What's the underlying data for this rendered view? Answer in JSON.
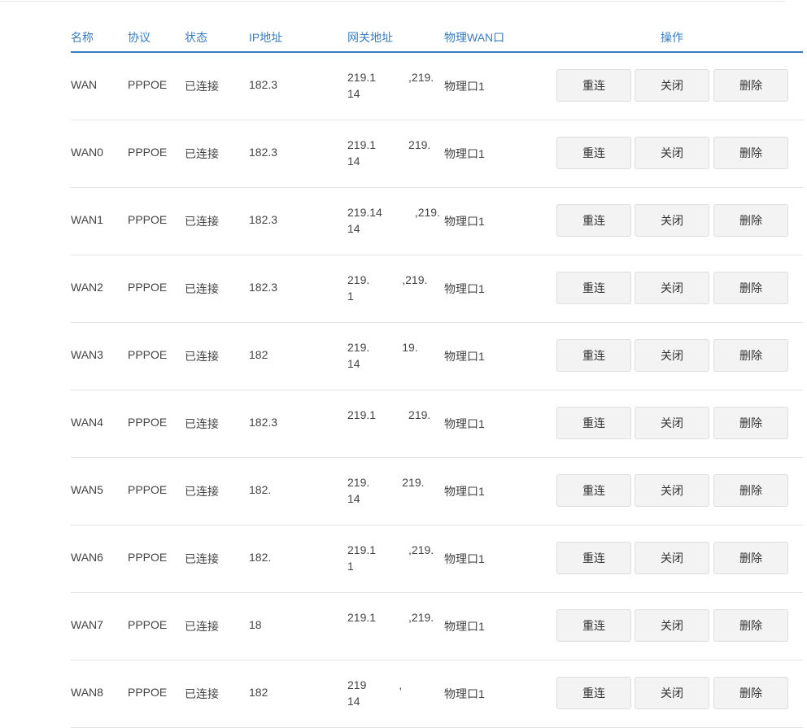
{
  "table": {
    "headers": {
      "name": "名称",
      "protocol": "协议",
      "status": "状态",
      "ip": "IP地址",
      "gateway": "网关地址",
      "port": "物理WAN口",
      "ops": "操作"
    },
    "rows": [
      {
        "name": "WAN",
        "protocol": "PPPOE",
        "status": "已连接",
        "ip": "182.3",
        "gateway_line1": "219.1",
        "gateway_tail": ",219.",
        "gateway_line2": "14",
        "port": "物理口1",
        "reconnect": "重连",
        "close": "关闭",
        "delete": "删除"
      },
      {
        "name": "WAN0",
        "protocol": "PPPOE",
        "status": "已连接",
        "ip": "182.3",
        "gateway_line1": "219.1",
        "gateway_tail": "219.",
        "gateway_line2": "14",
        "port": "物理口1",
        "reconnect": "重连",
        "close": "关闭",
        "delete": "删除"
      },
      {
        "name": "WAN1",
        "protocol": "PPPOE",
        "status": "已连接",
        "ip": "182.3",
        "gateway_line1": "219.14",
        "gateway_tail": ",219.",
        "gateway_line2": "14",
        "port": "物理口1",
        "reconnect": "重连",
        "close": "关闭",
        "delete": "删除"
      },
      {
        "name": "WAN2",
        "protocol": "PPPOE",
        "status": "已连接",
        "ip": "182.3",
        "gateway_line1": "219.",
        "gateway_tail": ",219.",
        "gateway_line2": "1",
        "port": "物理口1",
        "reconnect": "重连",
        "close": "关闭",
        "delete": "删除"
      },
      {
        "name": "WAN3",
        "protocol": "PPPOE",
        "status": "已连接",
        "ip": "182",
        "gateway_line1": "219.",
        "gateway_tail": "19.",
        "gateway_line2": "14",
        "port": "物理口1",
        "reconnect": "重连",
        "close": "关闭",
        "delete": "删除"
      },
      {
        "name": "WAN4",
        "protocol": "PPPOE",
        "status": "已连接",
        "ip": "182.3",
        "gateway_line1": "219.1",
        "gateway_tail": "219.",
        "gateway_line2": "",
        "port": "物理口1",
        "reconnect": "重连",
        "close": "关闭",
        "delete": "删除"
      },
      {
        "name": "WAN5",
        "protocol": "PPPOE",
        "status": "已连接",
        "ip": "182.",
        "gateway_line1": "219.",
        "gateway_tail": "219.",
        "gateway_line2": "14",
        "port": "物理口1",
        "reconnect": "重连",
        "close": "关闭",
        "delete": "删除"
      },
      {
        "name": "WAN6",
        "protocol": "PPPOE",
        "status": "已连接",
        "ip": "182.",
        "gateway_line1": "219.1",
        "gateway_tail": ",219.",
        "gateway_line2": "1",
        "port": "物理口1",
        "reconnect": "重连",
        "close": "关闭",
        "delete": "删除"
      },
      {
        "name": "WAN7",
        "protocol": "PPPOE",
        "status": "已连接",
        "ip": "18",
        "gateway_line1": "219.1",
        "gateway_tail": ",219.",
        "gateway_line2": "",
        "port": "物理口1",
        "reconnect": "重连",
        "close": "关闭",
        "delete": "删除"
      },
      {
        "name": "WAN8",
        "protocol": "PPPOE",
        "status": "已连接",
        "ip": "182",
        "gateway_line1": "219",
        "gateway_tail": ",",
        "gateway_line2": "14",
        "port": "物理口1",
        "reconnect": "重连",
        "close": "关闭",
        "delete": "删除"
      }
    ]
  }
}
